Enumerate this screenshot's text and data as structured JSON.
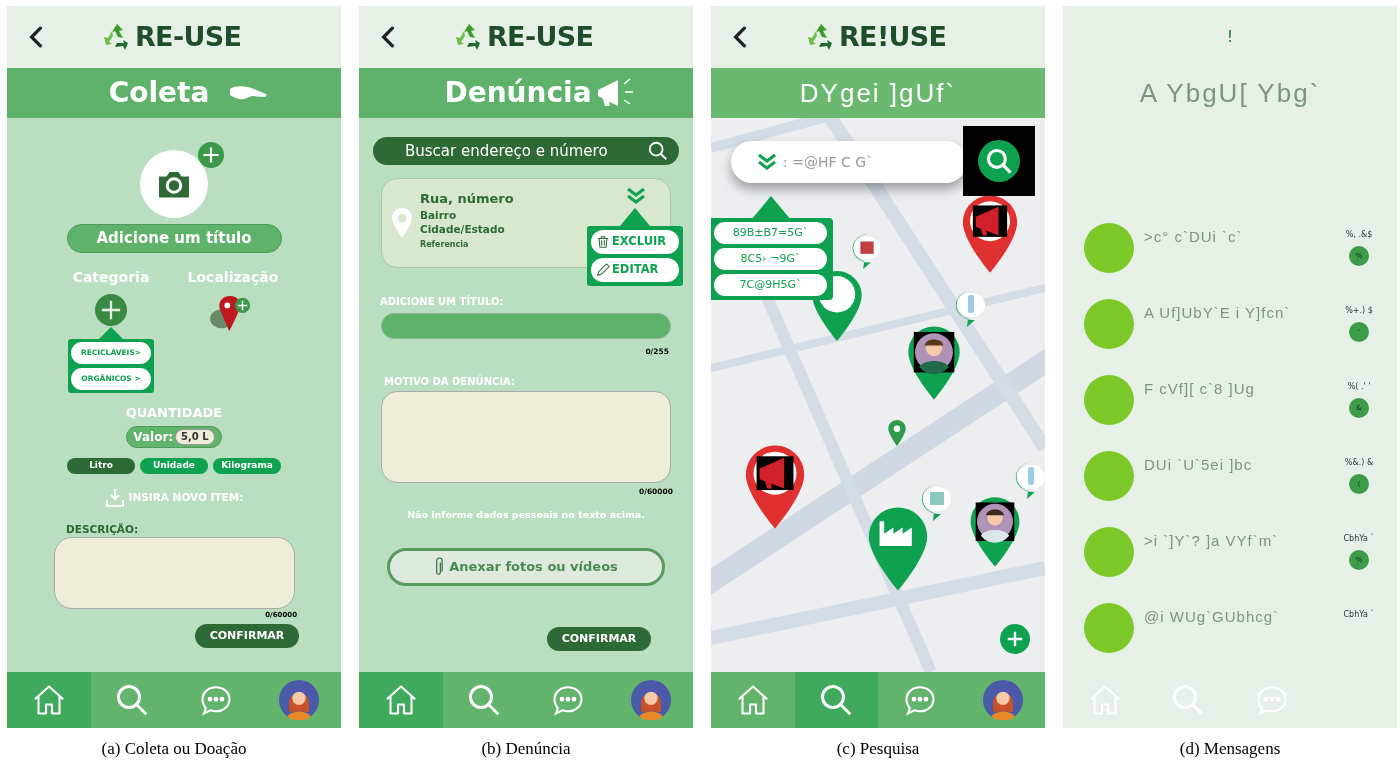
{
  "coleta": {
    "logo": "RE-USE",
    "title": "Coleta",
    "add_title": "Adicione um título",
    "category_label": "Categoria",
    "location_label": "Localização",
    "category_options": [
      "RECICLÁVEIS>",
      "ORGÂNICOS >"
    ],
    "quantity_label": "QUANTIDADE",
    "value_label": "Valor:",
    "value": "5,0 L",
    "units": [
      {
        "label": "Litro",
        "selected": true
      },
      {
        "label": "Unidade",
        "selected": false
      },
      {
        "label": "Kilograma",
        "selected": false
      }
    ],
    "new_item": "INSIRA NOVO ITEM:",
    "description_label": "DESCRIÇÃO:",
    "counter": "0/60000",
    "confirm": "CONFIRMAR",
    "nav": [
      {
        "kind": "home",
        "selected": true
      },
      {
        "kind": "search",
        "selected": false
      },
      {
        "kind": "chat",
        "selected": false
      },
      {
        "kind": "avatar",
        "selected": false
      }
    ],
    "caption": "(a) Coleta ou Doação"
  },
  "denuncia": {
    "logo": "RE-USE",
    "title": "Denúncia",
    "search_placeholder": "Buscar endereço e número",
    "address": {
      "street": "Rua, número",
      "district": "Bairro",
      "city": "Cidade/Estado",
      "reference": "Referencia"
    },
    "actions": [
      {
        "kind": "delete",
        "label": "EXCLUIR"
      },
      {
        "kind": "edit",
        "label": "EDITAR"
      }
    ],
    "title_label": "ADICIONE UM TÍTULO:",
    "title_counter": "0/255",
    "reason_label": "MOTIVO DA DENÚNCIA:",
    "reason_counter": "0/60000",
    "privacy_note": "Não informe dados pessoais no texto acima.",
    "attach": "Anexar fotos ou vídeos",
    "confirm": "CONFIRMAR",
    "nav": [
      {
        "kind": "home",
        "selected": true
      },
      {
        "kind": "search",
        "selected": false
      },
      {
        "kind": "chat",
        "selected": false
      },
      {
        "kind": "avatar",
        "selected": false
      }
    ],
    "caption": "(b)  Denúncia"
  },
  "pesquisa": {
    "logo": "RE!USE",
    "title": "DYgei ]gUf`",
    "search_placeholder": ": =@HF C G`",
    "filters": [
      "89B±B7=5G`",
      "8C5› ¬9G`",
      "7C@9H5G`"
    ],
    "nav": [
      {
        "kind": "home",
        "selected": false
      },
      {
        "kind": "search",
        "selected": true
      },
      {
        "kind": "chat",
        "selected": false
      },
      {
        "kind": "avatar",
        "selected": false
      }
    ],
    "caption": "(c) Pesquisa"
  },
  "mensagens": {
    "header_mark": "!",
    "title": "A YbgU[ Ybg`",
    "conversations": [
      {
        "name": ">c° c`DUi `c`",
        "time": "%, .&$",
        "unread": "%"
      },
      {
        "name": "A Uf]UbY`E i Y]fcn`",
        "time": "%+.) $",
        "unread": "'"
      },
      {
        "name": "F cVf][ c`8 ]Ug",
        "time": "%( .' '",
        "unread": "&"
      },
      {
        "name": "DUi `U`5ei ]bc",
        "time": "%&.) &",
        "unread": "("
      },
      {
        "name": ">i `]Y`? ]a VYf`m`",
        "time": "CbhYa `",
        "unread": "%"
      },
      {
        "name": "@i WUg`GUbhcg`",
        "time": "CbhYa `"
      }
    ],
    "nav": [
      {
        "kind": "home",
        "selected": false
      },
      {
        "kind": "search",
        "selected": false
      },
      {
        "kind": "chat",
        "selected": false
      }
    ],
    "caption": "(d) Mensagens"
  }
}
